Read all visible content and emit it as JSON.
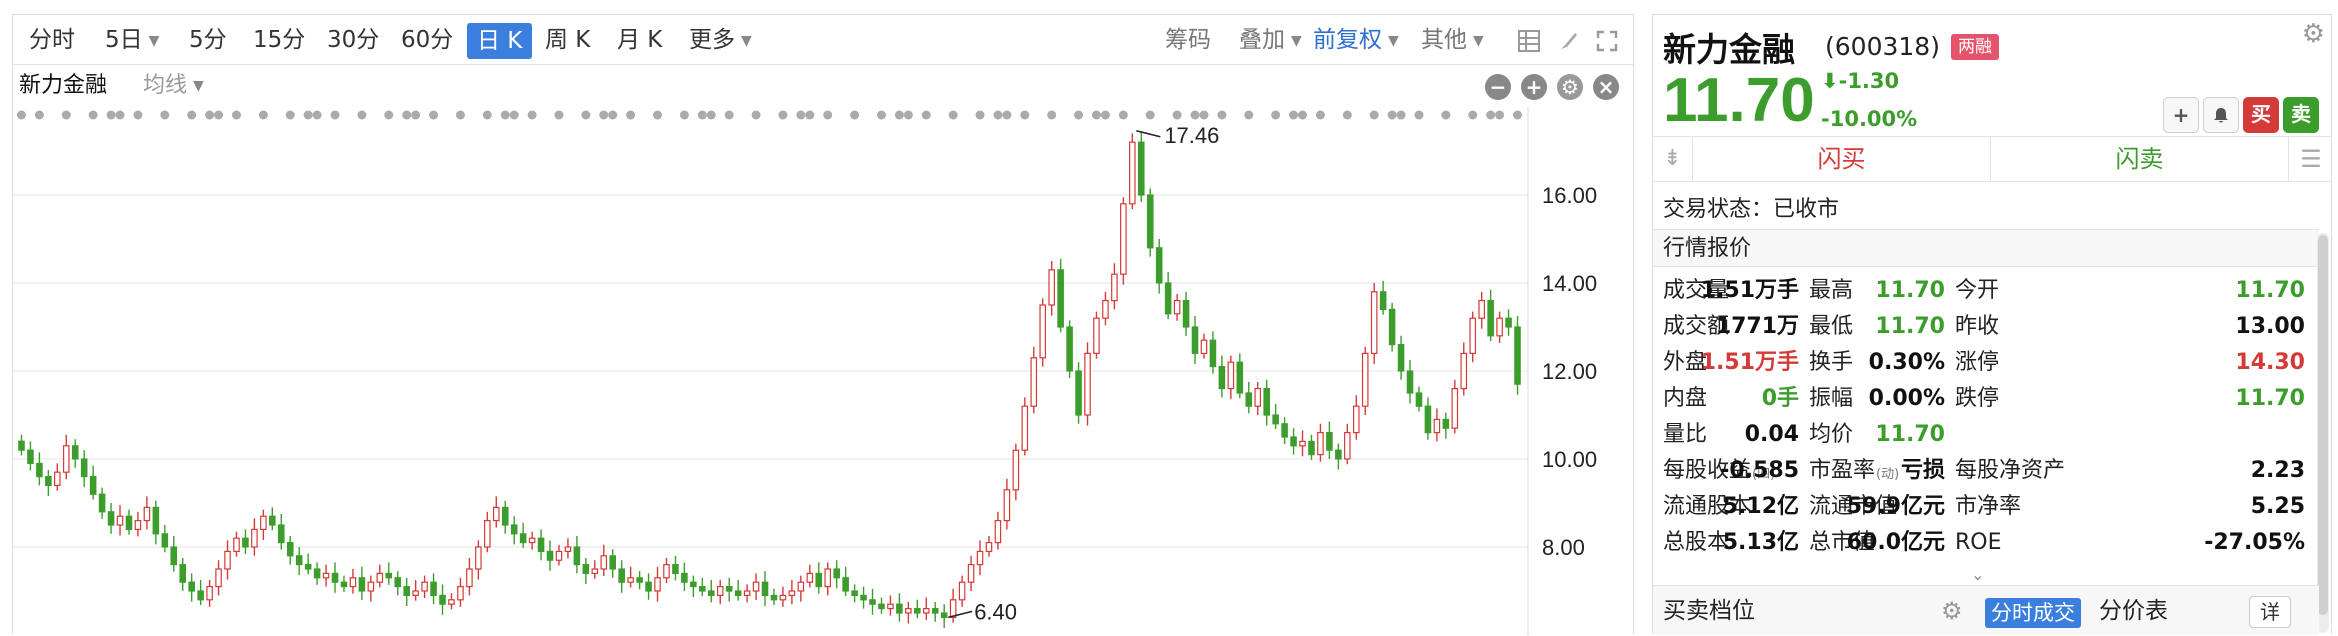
{
  "toolbar": {
    "periods": [
      "分时",
      "5日",
      "5分",
      "15分",
      "30分",
      "60分",
      "日 K",
      "周 K",
      "月 K",
      "更多"
    ],
    "active_period": "日 K",
    "chips": "筹码",
    "overlay": "叠加",
    "adjust": "前复权",
    "other": "其他"
  },
  "chart_header": {
    "stock_tab": "新力金融",
    "ma_label": "均线"
  },
  "chart_data": {
    "type": "candlestick",
    "y_axis_ticks": [
      "16.00",
      "14.00",
      "12.00",
      "10.00",
      "8.00"
    ],
    "ylim": [
      6.0,
      18.0
    ],
    "annotations": [
      {
        "label": "17.46",
        "value": 17.46
      },
      {
        "label": "6.40",
        "value": 6.4
      }
    ],
    "colors": {
      "up": "#d43a37",
      "down": "#3c9d2d",
      "grid": "#e6e6e6",
      "marker": "#aaaaaa"
    },
    "closes": [
      10.2,
      9.9,
      9.6,
      9.4,
      9.7,
      10.3,
      10.0,
      9.6,
      9.2,
      8.8,
      8.5,
      8.7,
      8.4,
      8.6,
      8.9,
      8.3,
      8.0,
      7.6,
      7.2,
      7.0,
      6.8,
      7.1,
      7.5,
      7.9,
      8.2,
      8.0,
      8.4,
      8.7,
      8.5,
      8.1,
      7.8,
      7.6,
      7.5,
      7.3,
      7.4,
      7.2,
      7.1,
      7.3,
      7.0,
      7.2,
      7.4,
      7.3,
      7.1,
      6.9,
      7.0,
      7.2,
      6.9,
      6.7,
      6.8,
      7.1,
      7.5,
      8.0,
      8.6,
      8.9,
      8.5,
      8.3,
      8.1,
      8.2,
      7.9,
      7.7,
      7.9,
      8.0,
      7.6,
      7.4,
      7.5,
      7.8,
      7.5,
      7.2,
      7.3,
      7.2,
      7.0,
      7.3,
      7.6,
      7.4,
      7.2,
      7.1,
      7.0,
      6.9,
      7.1,
      7.0,
      6.9,
      7.0,
      7.2,
      6.9,
      6.8,
      6.9,
      7.0,
      7.2,
      7.4,
      7.1,
      7.5,
      7.3,
      7.0,
      6.9,
      6.8,
      6.7,
      6.6,
      6.7,
      6.5,
      6.6,
      6.5,
      6.6,
      6.5,
      6.4,
      6.8,
      7.2,
      7.6,
      7.9,
      8.1,
      8.6,
      9.3,
      10.2,
      11.2,
      12.3,
      13.5,
      14.3,
      13.0,
      12.0,
      11.0,
      12.4,
      13.2,
      13.6,
      14.2,
      15.8,
      17.2,
      16.0,
      14.8,
      14.0,
      13.3,
      13.6,
      13.0,
      12.4,
      12.7,
      12.1,
      11.6,
      12.2,
      11.5,
      11.2,
      11.6,
      11.0,
      10.8,
      10.5,
      10.3,
      10.4,
      10.1,
      10.6,
      10.2,
      10.0,
      10.6,
      11.2,
      12.4,
      13.8,
      13.4,
      12.6,
      12.0,
      11.5,
      11.2,
      10.6,
      10.9,
      10.7,
      11.6,
      12.4,
      13.2,
      13.6,
      12.8,
      13.2,
      13.0,
      11.7
    ]
  },
  "quote": {
    "name": "新力金融",
    "code": "(600318)",
    "badge": "两融",
    "price": "11.70",
    "change": "-1.30",
    "change_pct": "-10.00%",
    "buy_btn": "买",
    "sell_btn": "卖",
    "flash_buy": "闪买",
    "flash_sell": "闪卖",
    "trade_status": "交易状态：已收市",
    "section_title": "行情报价",
    "rows": [
      [
        {
          "l": "成交量",
          "v": "1.51万手",
          "c": ""
        },
        {
          "l": "最高",
          "v": "11.70",
          "c": "green"
        },
        {
          "l": "今开",
          "v": "11.70",
          "c": "green"
        }
      ],
      [
        {
          "l": "成交额",
          "v": "1771万",
          "c": ""
        },
        {
          "l": "最低",
          "v": "11.70",
          "c": "green"
        },
        {
          "l": "昨收",
          "v": "13.00",
          "c": ""
        }
      ],
      [
        {
          "l": "外盘",
          "v": "1.51万手",
          "c": "red"
        },
        {
          "l": "换手",
          "v": "0.30%",
          "c": ""
        },
        {
          "l": "涨停",
          "v": "14.30",
          "c": "red"
        }
      ],
      [
        {
          "l": "内盘",
          "v": "0手",
          "c": "green"
        },
        {
          "l": "振幅",
          "v": "0.00%",
          "c": ""
        },
        {
          "l": "跌停",
          "v": "11.70",
          "c": "green"
        }
      ],
      [
        {
          "l": "量比",
          "v": "0.04",
          "c": ""
        },
        {
          "l": "均价",
          "v": "11.70",
          "c": "green"
        },
        {
          "l": "",
          "v": "",
          "c": ""
        }
      ],
      [
        {
          "l": "每股收益",
          "sub": "(四)",
          "v": "-0.585",
          "c": ""
        },
        {
          "l": "市盈率",
          "sub": "(动)",
          "v": "亏损",
          "c": ""
        },
        {
          "l": "每股净资产",
          "v": "2.23",
          "c": ""
        }
      ],
      [
        {
          "l": "流通股本",
          "v": "5.12亿",
          "c": ""
        },
        {
          "l": "流通市值",
          "v": "59.9亿元",
          "c": ""
        },
        {
          "l": "市净率",
          "v": "5.25",
          "c": ""
        }
      ],
      [
        {
          "l": "总股本",
          "v": "5.13亿",
          "c": ""
        },
        {
          "l": "总市值",
          "v": "60.0亿元",
          "c": ""
        },
        {
          "l": "ROE",
          "v": "-27.05%",
          "c": ""
        }
      ]
    ]
  },
  "bottom_tabs": {
    "orderbook": "买卖档位",
    "ticks": "分时成交",
    "price_table": "分价表",
    "detail": "详"
  },
  "icons": [
    "chevron-down-icon",
    "grid-icon",
    "brush-icon",
    "fullscreen-icon",
    "minus-circle-icon",
    "plus-circle-icon",
    "gear-icon",
    "close-circle-icon",
    "plus-icon",
    "bell-icon",
    "down-arrow-icon",
    "menu-icon"
  ]
}
